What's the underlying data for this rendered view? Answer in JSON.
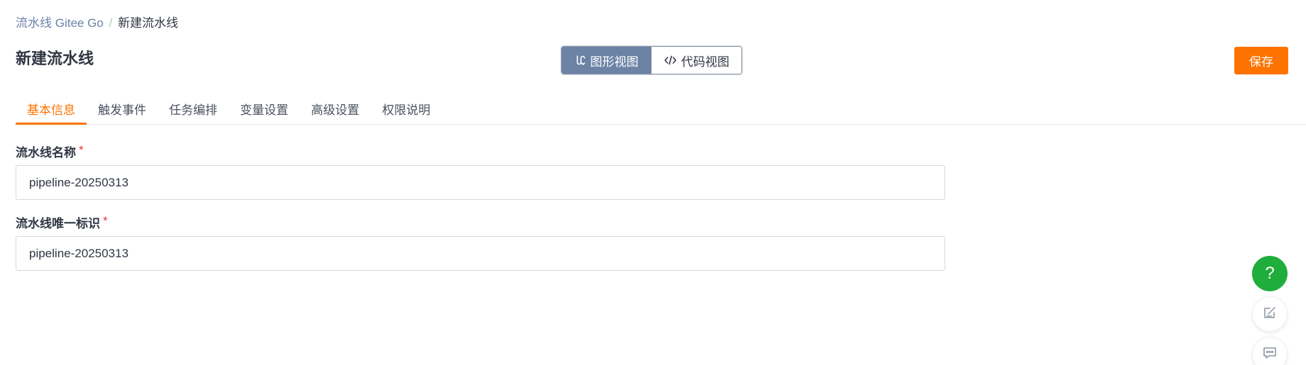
{
  "breadcrumb": {
    "parent": "流水线 Gitee Go",
    "separator": "/",
    "current": "新建流水线"
  },
  "page_title": "新建流水线",
  "view_switch": {
    "graphic_label": "图形视图",
    "code_label": "代码视图",
    "active": "graphic"
  },
  "save_label": "保存",
  "tabs": [
    {
      "label": "基本信息",
      "active": true
    },
    {
      "label": "触发事件",
      "active": false
    },
    {
      "label": "任务编排",
      "active": false
    },
    {
      "label": "变量设置",
      "active": false
    },
    {
      "label": "高级设置",
      "active": false
    },
    {
      "label": "权限说明",
      "active": false
    }
  ],
  "form": {
    "name_label": "流水线名称",
    "name_value": "pipeline-20250313",
    "id_label": "流水线唯一标识",
    "id_value": "pipeline-20250313",
    "required_mark": "*"
  },
  "float_buttons": {
    "help_glyph": "?",
    "help_icon": "question-icon",
    "edit_icon": "edit-note-icon",
    "chat_icon": "chat-bubble-icon"
  },
  "colors": {
    "accent": "#fe7300",
    "switch_active": "#6c83a6",
    "help_green": "#1fad3b",
    "required": "#e2363b"
  }
}
